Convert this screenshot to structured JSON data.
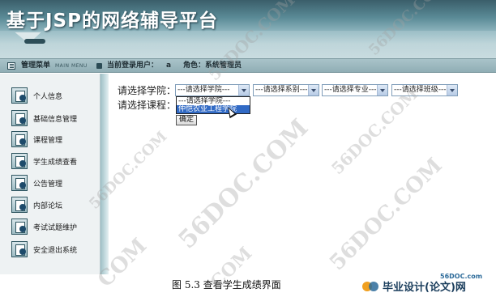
{
  "app": {
    "title": "基于JSP的网络辅导平台"
  },
  "statusbar": {
    "menu_label": "管理菜单",
    "menu_sub": "MAIN MENU",
    "user_label": "当前登录用户：",
    "user_value": "a",
    "role_label": "角色：系统管理员"
  },
  "sidebar": {
    "items": [
      {
        "label": "个人信息",
        "icon": "document-icon"
      },
      {
        "label": "基础信息管理",
        "icon": "document-icon"
      },
      {
        "label": "课程管理",
        "icon": "document-icon"
      },
      {
        "label": "学生成绩查看",
        "icon": "document-icon"
      },
      {
        "label": "公告管理",
        "icon": "document-icon"
      },
      {
        "label": "内部论坛",
        "icon": "document-icon"
      },
      {
        "label": "考试试题维护",
        "icon": "document-icon"
      },
      {
        "label": "安全退出系统",
        "icon": "document-icon"
      }
    ]
  },
  "main": {
    "college_label": "请选择学院：",
    "course_label": "请选择课程：",
    "college_select": "---请选择学院---",
    "dept_select": "---请选择系别---",
    "major_select": "---请选择专业---",
    "class_select": "---请选择班级---",
    "dropdown_options": [
      "---请选择学院---",
      "仲恺农业工程学院"
    ],
    "confirm_button": "确定"
  },
  "footer": {
    "caption": "图 5.3 查看学生成绩界面",
    "logo_small": "56DOC.com",
    "logo_text": "毕业设计(论文)网"
  },
  "watermarks": [
    "56DOC.COM",
    "56DOC.COM",
    "56DOC.COM",
    "56DOC.COM",
    "56DOC.COM",
    "COM",
    "COM",
    "56DOC.COM"
  ],
  "colors": {
    "banner_dark": "#3a5e6a",
    "statusbar": "#a9c3c9",
    "sidebar_bg": "#eef2f3",
    "select_border": "#7f9db9",
    "highlight": "#316ac5"
  }
}
